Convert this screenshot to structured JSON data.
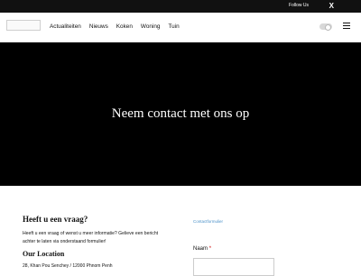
{
  "topbar": {
    "follow_label": "Follow Us",
    "x_icon": "X"
  },
  "nav": {
    "items": [
      "Actualiteiten",
      "Nieuws",
      "Koken",
      "Woning",
      "Tuin"
    ]
  },
  "hero": {
    "title": "Neem contact met ons op"
  },
  "contact": {
    "heading": "Heeft u een vraag?",
    "text": "Heeft u een vraag of wenst u meer informatie? Gelieve een bericht achter te laten via onderstaand formulier!",
    "location_heading": "Our Location",
    "address": "28, Khan Pou Senchey / 12000 Phnom Penh"
  },
  "form": {
    "label": "Contactformulier",
    "name_label": "Naam",
    "required_marker": "*",
    "name_value": ""
  }
}
